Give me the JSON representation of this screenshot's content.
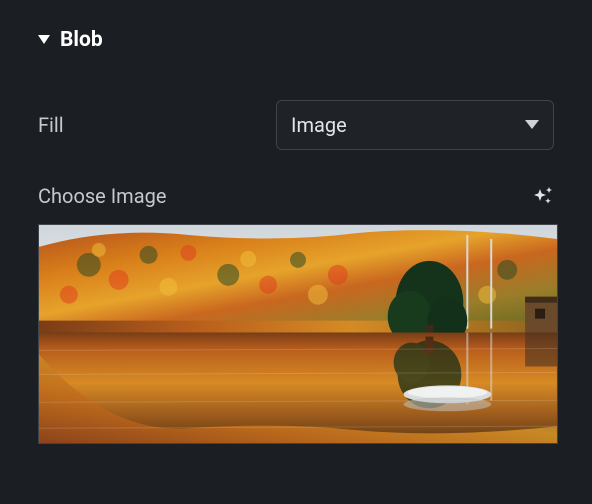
{
  "section": {
    "title": "Blob"
  },
  "fill": {
    "label": "Fill",
    "selected": "Image"
  },
  "choose": {
    "label": "Choose Image"
  },
  "icons": {
    "section_caret": "triangle-down-icon",
    "select_caret": "triangle-down-icon",
    "sparkle": "sparkle-icon"
  }
}
